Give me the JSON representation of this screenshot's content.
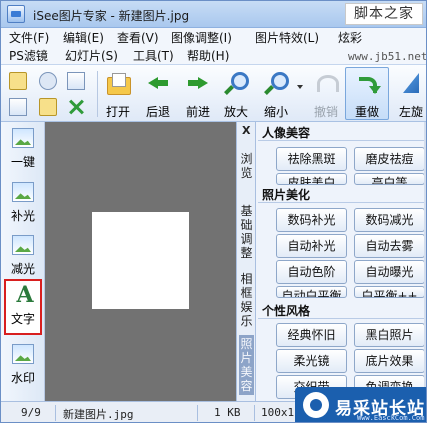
{
  "window": {
    "title": "iSee图片专家 - 新建图片.jpg"
  },
  "watermark_top": {
    "text": "脚本之家",
    "url": "www.jb51.net"
  },
  "menu": {
    "row1": [
      "文件(F)",
      "编辑(E)",
      "查看(V)",
      "图像调整(I)",
      "图片特效(L)",
      "炫彩"
    ],
    "row2": [
      "PS滤镜",
      "幻灯片(S)",
      "工具(T)",
      "帮助(H)"
    ]
  },
  "toolbar": {
    "open": "打开",
    "back": "后退",
    "forward": "前进",
    "zoom_in": "放大",
    "zoom_out": "缩小",
    "undo": "撤销",
    "redo": "重做",
    "rotate_left": "左旋"
  },
  "side_tools": [
    "一键",
    "补光",
    "减光",
    "文字",
    "水印"
  ],
  "side_selected": "文字",
  "tabs": {
    "close": "X",
    "items": [
      "浏览",
      "基础调整",
      "相框娱乐",
      "照片美容"
    ],
    "active": "照片美容"
  },
  "panel": {
    "sections": [
      {
        "title": "人像美容",
        "buttons": [
          "祛除黑斑",
          "磨皮祛痘",
          "皮肤美白",
          "亮白等"
        ]
      },
      {
        "title": "照片美化",
        "buttons": [
          "数码补光",
          "数码减光",
          "自动补光",
          "自动去雾",
          "自动色阶",
          "自动曝光",
          "自动白平衡",
          "白平衡++"
        ]
      },
      {
        "title": "个性风格",
        "buttons": [
          "经典怀旧",
          "黑白照片",
          "柔光镜",
          "底片效果",
          "交织带",
          "色调变换"
        ]
      }
    ]
  },
  "status": {
    "count": "9/9",
    "filename": "新建图片.jpg",
    "size": "1 KB",
    "dims": "100x1"
  },
  "logo": {
    "text": "易采站长站",
    "url": "Www.EasckCom.Com"
  }
}
